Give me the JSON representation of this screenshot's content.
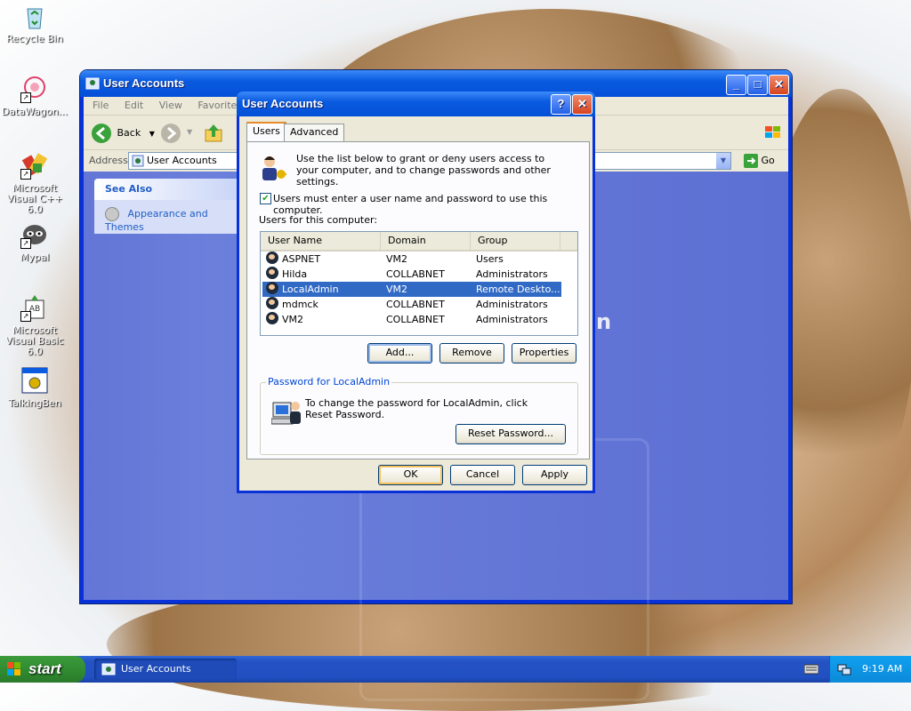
{
  "desktop": {
    "icons": [
      {
        "label": "Recycle Bin"
      },
      {
        "label": "DataWagon..."
      },
      {
        "label": "Microsoft Visual C++ 6.0"
      },
      {
        "label": "Mypal"
      },
      {
        "label": "Microsoft Visual Basic 6.0"
      },
      {
        "label": "TalkingBen"
      }
    ]
  },
  "explorer": {
    "title": "User Accounts",
    "menu": [
      "File",
      "Edit",
      "View",
      "Favorites"
    ],
    "toolbar": {
      "back_label": "Back"
    },
    "address": {
      "label": "Address",
      "value": "User Accounts",
      "go_label": "Go"
    },
    "see_also": {
      "header": "See Also",
      "item": "Appearance and Themes"
    },
    "partial_text": "n"
  },
  "dialog": {
    "title": "User Accounts",
    "help_glyph": "?",
    "tabs": [
      "Users",
      "Advanced"
    ],
    "intro": "Use the list below to grant or deny users access to your computer, and to change passwords and other settings.",
    "checkbox_label": "Users must enter a user name and password to use this computer.",
    "checkbox_checked": true,
    "list_label": "Users for this computer:",
    "columns": [
      "User Name",
      "Domain",
      "Group"
    ],
    "users": [
      {
        "name": "ASPNET",
        "domain": "VM2",
        "group": "Users"
      },
      {
        "name": "Hilda",
        "domain": "COLLABNET",
        "group": "Administrators"
      },
      {
        "name": "LocalAdmin",
        "domain": "VM2",
        "group": "Remote Deskto..."
      },
      {
        "name": "mdmck",
        "domain": "COLLABNET",
        "group": "Administrators"
      },
      {
        "name": "VM2",
        "domain": "COLLABNET",
        "group": "Administrators"
      }
    ],
    "selected_user": "LocalAdmin",
    "buttons": {
      "add": "Add...",
      "remove": "Remove",
      "properties": "Properties"
    },
    "password_group": {
      "legend": "Password for LocalAdmin",
      "text": "To change the password for LocalAdmin, click Reset Password.",
      "reset_button": "Reset Password..."
    },
    "footer": {
      "ok": "OK",
      "cancel": "Cancel",
      "apply": "Apply"
    }
  },
  "taskbar": {
    "start_label": "start",
    "task_button": "User Accounts",
    "clock": "9:19 AM"
  }
}
